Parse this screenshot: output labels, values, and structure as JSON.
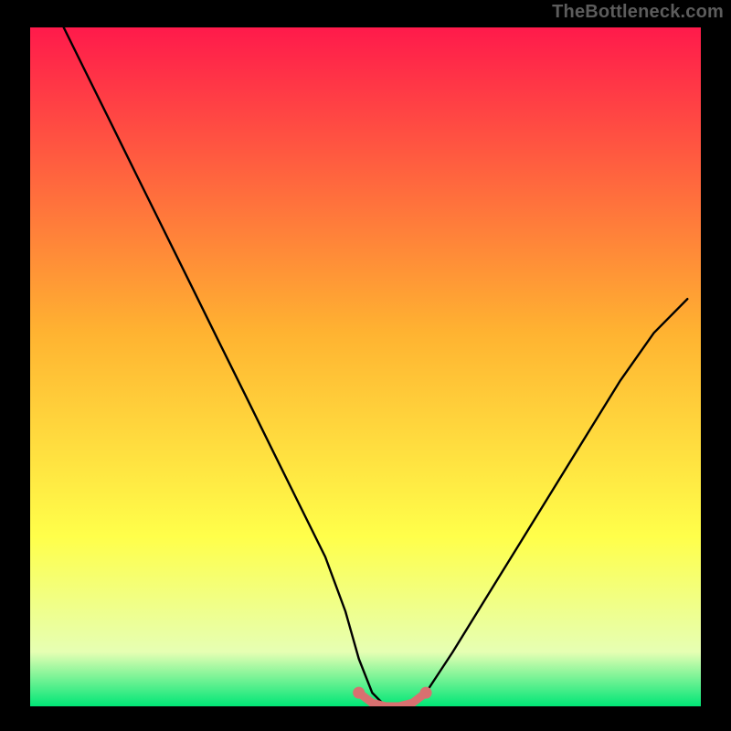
{
  "watermark": "TheBottleneck.com",
  "colors": {
    "black": "#000000",
    "gradient_top": "#ff1a4b",
    "gradient_mid_orange": "#ffb331",
    "gradient_yellow": "#ffff4a",
    "gradient_light": "#e6ffb3",
    "gradient_green": "#00e676",
    "curve": "#000000",
    "marker": "#d87070"
  },
  "chart_data": {
    "type": "line",
    "title": "",
    "xlabel": "",
    "ylabel": "",
    "xlim": [
      0,
      100
    ],
    "ylim": [
      0,
      100
    ],
    "axes_visible": false,
    "grid": false,
    "description": "Bottleneck percentage curve with a single minimum valley; background is a vertical rainbow gradient (red top → green bottom) inside a thick black frame.",
    "series": [
      {
        "name": "bottleneck-curve",
        "x": [
          5,
          8,
          12,
          16,
          20,
          24,
          28,
          32,
          36,
          40,
          44,
          47,
          49,
          51,
          53,
          55,
          57,
          59,
          63,
          68,
          73,
          78,
          83,
          88,
          93,
          98
        ],
        "y": [
          100,
          94,
          86,
          78,
          70,
          62,
          54,
          46,
          38,
          30,
          22,
          14,
          7,
          2,
          0,
          0,
          0,
          2,
          8,
          16,
          24,
          32,
          40,
          48,
          55,
          60
        ]
      }
    ],
    "markers": {
      "name": "valley-highlight",
      "x": [
        49,
        51,
        53,
        55,
        57,
        59
      ],
      "y": [
        2,
        0.5,
        0,
        0,
        0.5,
        2
      ]
    }
  }
}
